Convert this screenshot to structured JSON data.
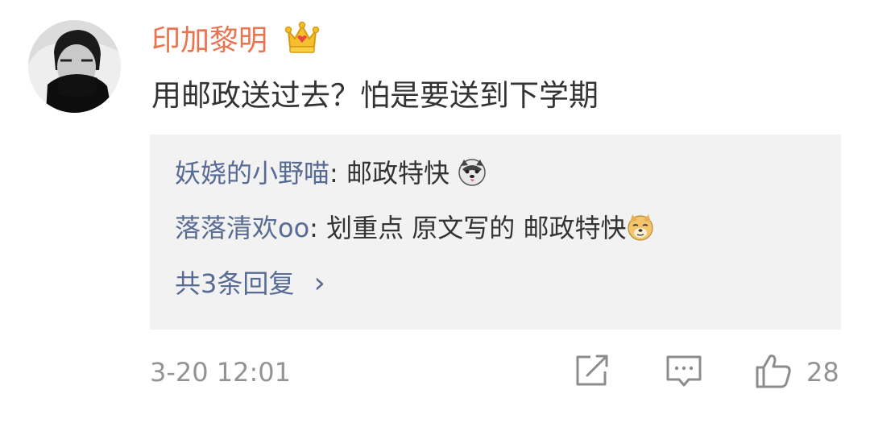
{
  "comment": {
    "username": "印加黎明",
    "badge_icon": "crown-icon",
    "text": "用邮政送过去？怕是要送到下学期",
    "timestamp": "3-20 12:01",
    "like_count": "28",
    "replies": [
      {
        "author": "妖娆的小野喵",
        "separator": ": ",
        "text": "邮政特快 ",
        "emoji": "husky-emoji"
      },
      {
        "author": "落落清欢oo",
        "separator": ": ",
        "text": "划重点 原文写的 邮政特快",
        "emoji": "doge-emoji"
      }
    ],
    "more_replies_label": "共3条回复",
    "more_replies_chevron": "›"
  },
  "colors": {
    "username": "#eb7350",
    "link": "#576b95",
    "text": "#333333",
    "meta": "#939393",
    "reply_bg": "#f2f2f2"
  }
}
